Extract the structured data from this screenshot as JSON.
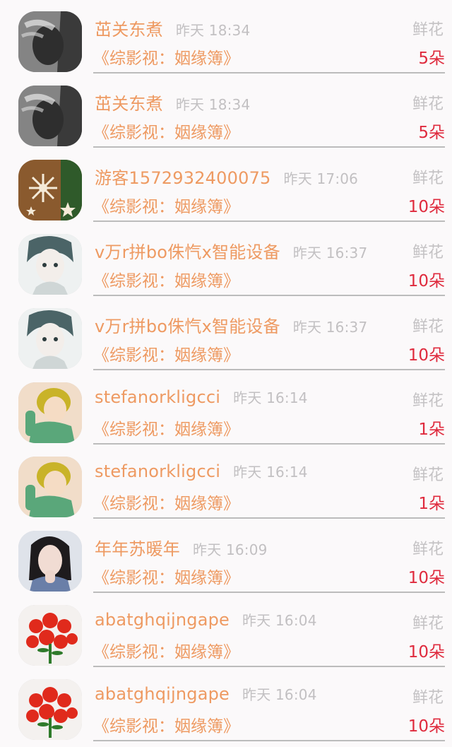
{
  "items": [
    {
      "name": "茁关东煮",
      "time": "昨天 18:34",
      "type": "鲜花",
      "book": "《综影视：姻缘簿》",
      "count": "5朵",
      "avatar_icon": "smoking-person-avatar-icon"
    },
    {
      "name": "茁关东煮",
      "time": "昨天 18:34",
      "type": "鲜花",
      "book": "《综影视：姻缘簿》",
      "count": "5朵",
      "avatar_icon": "smoking-person-avatar-icon"
    },
    {
      "name": "游客1572932400075",
      "time": "昨天 17:06",
      "type": "鲜花",
      "book": "《综影视：姻缘簿》",
      "count": "10朵",
      "avatar_icon": "snowflake-avatar-icon"
    },
    {
      "name": "v万r拼bo侏忾x智能设备",
      "time": "昨天 16:37",
      "type": "鲜花",
      "book": "《综影视：姻缘簿》",
      "count": "10朵",
      "avatar_icon": "anime-boy-avatar-icon"
    },
    {
      "name": "v万r拼bo侏忾x智能设备",
      "time": "昨天 16:37",
      "type": "鲜花",
      "book": "《综影视：姻缘簿》",
      "count": "10朵",
      "avatar_icon": "anime-boy-avatar-icon"
    },
    {
      "name": "stefanorkligcci",
      "time": "昨天 16:14",
      "type": "鲜花",
      "book": "《综影视：姻缘簿》",
      "count": "1朵",
      "avatar_icon": "illustrated-boy-avatar-icon"
    },
    {
      "name": "stefanorkligcci",
      "time": "昨天 16:14",
      "type": "鲜花",
      "book": "《综影视：姻缘簿》",
      "count": "1朵",
      "avatar_icon": "illustrated-boy-avatar-icon"
    },
    {
      "name": "年年苏暖年",
      "time": "昨天 16:09",
      "type": "鲜花",
      "book": "《综影视：姻缘簿》",
      "count": "10朵",
      "avatar_icon": "woman-portrait-avatar-icon"
    },
    {
      "name": "abatghqijngape",
      "time": "昨天 16:04",
      "type": "鲜花",
      "book": "《综影视：姻缘簿》",
      "count": "10朵",
      "avatar_icon": "red-flowers-avatar-icon"
    },
    {
      "name": "abatghqijngape",
      "time": "昨天 16:04",
      "type": "鲜花",
      "book": "《综影视：姻缘簿》",
      "count": "10朵",
      "avatar_icon": "red-flowers-avatar-icon"
    }
  ],
  "colors": {
    "name": "#ee9a62",
    "count": "#df2a3d",
    "muted": "#c2c0c2",
    "divider": "#bcbcbc",
    "background": "#fbf9fa"
  }
}
